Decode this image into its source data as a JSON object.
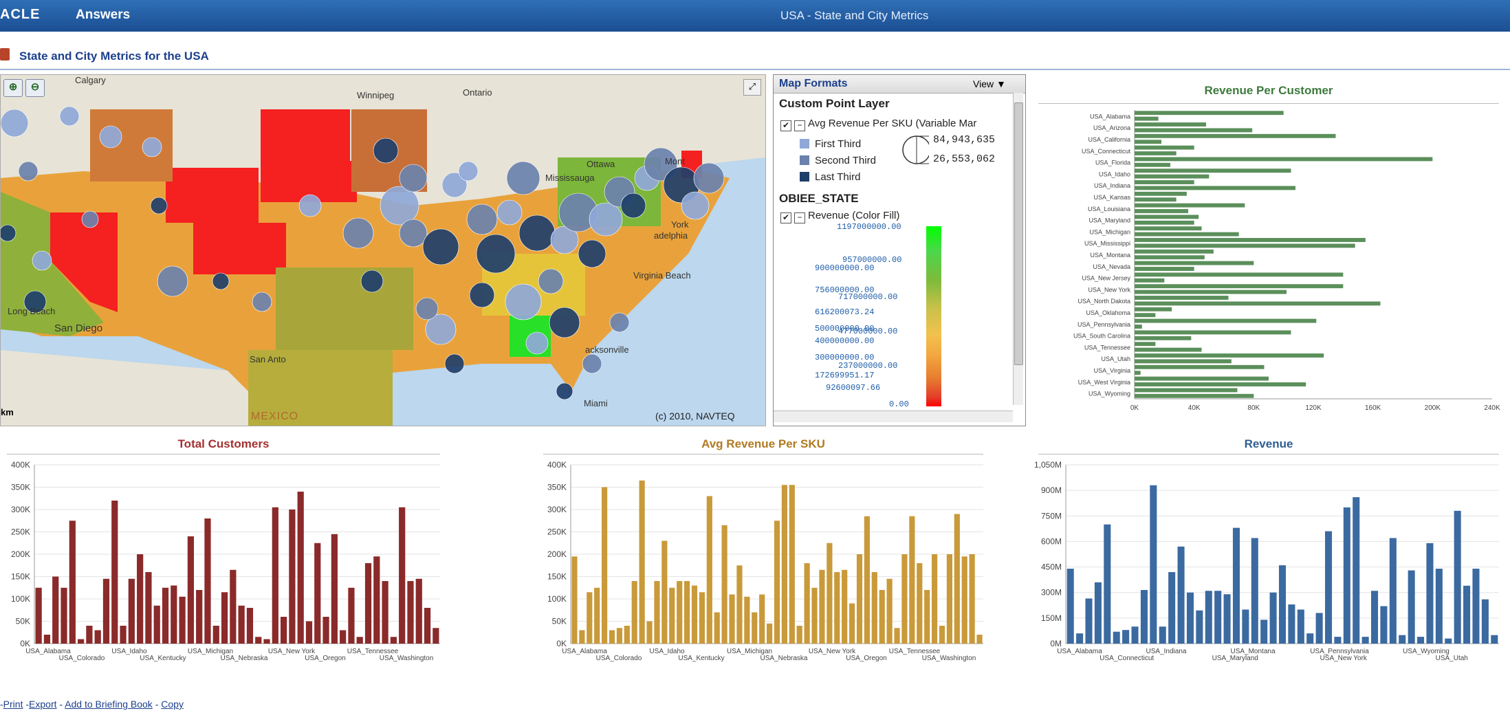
{
  "header": {
    "brand": "ACLE",
    "app": "Answers",
    "page_title": "USA - State and City Metrics"
  },
  "dashboard": {
    "title": "State and City Metrics for the USA"
  },
  "map": {
    "labels": {
      "calgary": "Calgary",
      "winnipeg": "Winnipeg",
      "ontario": "Ontario",
      "ottawa": "Ottawa",
      "montreal": "Mont",
      "mississauga": "Mississauga",
      "virginia_beach": "Virginia Beach",
      "new_york": "York",
      "philadelphia": "adelphia",
      "jacksonville": "acksonville",
      "miami": "Miami",
      "san_diego": "San Diego",
      "long_beach": "Long Beach",
      "san_antonio": "San Anto",
      "mexico": "MEXICO"
    },
    "scale_label": "km",
    "copyright": "(c) 2010, NAVTEQ"
  },
  "legend": {
    "header": "Map Formats",
    "view": "View ▼",
    "layer1_title": "Custom Point Layer",
    "layer1_item": "Avg Revenue Per SKU (Variable Mar",
    "first_third": "First Third",
    "second_third": "Second Third",
    "last_third": "Last Third",
    "max_value": "84,943,635",
    "min_value": "26,553,062",
    "colors": {
      "first": "#8fa8d8",
      "second": "#6b82ad",
      "last": "#1f3f6b"
    },
    "layer2_title": "OBIEE_STATE",
    "layer2_item": "Revenue (Color Fill)",
    "gradient_ticks": [
      "1197000000.00",
      "957000000.00",
      "900000000.00",
      "756000000.00",
      "717000000.00",
      "616200073.24",
      "500000000.00",
      "477000000.00",
      "400000000.00",
      "300000000.00",
      "237000000.00",
      "172699951.17",
      "92600097.66",
      "0.00"
    ]
  },
  "charts": {
    "total_customers": {
      "title": "Total Customers",
      "color": "#8b2a2a"
    },
    "avg_revenue_sku": {
      "title": "Avg Revenue Per SKU",
      "color": "#c99a3a"
    },
    "revenue": {
      "title": "Revenue",
      "color": "#3b6aa0"
    },
    "revenue_per_customer": {
      "title": "Revenue Per Customer",
      "color": "#5b8f5b"
    }
  },
  "chart_data": [
    {
      "type": "bar",
      "title": "Revenue Per Customer",
      "orientation": "horizontal",
      "categories": [
        "USA_Alabama",
        "USA_Arizona",
        "USA_California",
        "USA_Connecticut",
        "USA_Florida",
        "USA_Idaho",
        "USA_Indiana",
        "USA_Kansas",
        "USA_Louisiana",
        "USA_Maryland",
        "USA_Michigan",
        "USA_Mississippi",
        "USA_Montana",
        "USA_Nevada",
        "USA_New Jersey",
        "USA_New York",
        "USA_North Dakota",
        "USA_Oklahoma",
        "USA_Pennsylvania",
        "USA_South Carolina",
        "USA_Tennessee",
        "USA_Utah",
        "USA_Virginia",
        "USA_West Virginia",
        "USA_Wyoming"
      ],
      "values": [
        100000,
        16000,
        48000,
        79000,
        135000,
        18000,
        40000,
        28000,
        200000,
        24000,
        105000,
        50000,
        40000,
        108000,
        35000,
        28000,
        74000,
        36000,
        43000,
        40000,
        45000,
        70000,
        155000,
        148000,
        53000,
        47000,
        80000,
        40000,
        140000,
        20000,
        140000,
        102000,
        63000,
        165000,
        25000,
        14000,
        122000,
        5000,
        105000,
        38000,
        14000,
        45000,
        127000,
        65000,
        87000,
        4000,
        90000,
        115000,
        69000,
        80000
      ],
      "xticks": [
        "0K",
        "40K",
        "80K",
        "120K",
        "160K",
        "200K",
        "240K"
      ],
      "xlim": [
        0,
        240000
      ]
    },
    {
      "type": "bar",
      "title": "Total Customers",
      "yticks": [
        "0K",
        "50K",
        "100K",
        "150K",
        "200K",
        "250K",
        "300K",
        "350K",
        "400K"
      ],
      "ylim": [
        0,
        400000
      ],
      "xlabels_top": [
        "USA_Alabama",
        "USA_Idaho",
        "USA_Michigan",
        "USA_New York",
        "USA_Tennessee"
      ],
      "xlabels_bottom": [
        "USA_Colorado",
        "USA_Kentucky",
        "USA_Nebraska",
        "USA_Oregon",
        "USA_Washington"
      ],
      "values": [
        125000,
        20000,
        150000,
        125000,
        275000,
        10000,
        40000,
        30000,
        145000,
        320000,
        40000,
        145000,
        200000,
        160000,
        85000,
        125000,
        130000,
        105000,
        240000,
        120000,
        280000,
        40000,
        115000,
        165000,
        85000,
        80000,
        15000,
        10000,
        305000,
        60000,
        300000,
        340000,
        50000,
        225000,
        60000,
        245000,
        30000,
        125000,
        15000,
        180000,
        195000,
        140000,
        15000,
        305000,
        140000,
        145000,
        80000,
        35000
      ]
    },
    {
      "type": "bar",
      "title": "Avg Revenue Per SKU",
      "yticks": [
        "0K",
        "50K",
        "100K",
        "150K",
        "200K",
        "250K",
        "300K",
        "350K",
        "400K"
      ],
      "ylim": [
        0,
        400000
      ],
      "xlabels_top": [
        "USA_Alabama",
        "USA_Idaho",
        "USA_Michigan",
        "USA_New York",
        "USA_Tennessee"
      ],
      "xlabels_bottom": [
        "USA_Colorado",
        "USA_Kentucky",
        "USA_Nebraska",
        "USA_Oregon",
        "USA_Washington"
      ],
      "values": [
        195000,
        30000,
        115000,
        125000,
        350000,
        30000,
        35000,
        40000,
        140000,
        365000,
        50000,
        140000,
        230000,
        125000,
        140000,
        140000,
        130000,
        115000,
        330000,
        70000,
        265000,
        110000,
        175000,
        105000,
        70000,
        110000,
        45000,
        275000,
        355000,
        355000,
        40000,
        180000,
        125000,
        165000,
        225000,
        160000,
        165000,
        90000,
        200000,
        285000,
        160000,
        120000,
        145000,
        35000,
        200000,
        285000,
        180000,
        120000,
        200000,
        40000,
        200000,
        290000,
        195000,
        200000,
        20000
      ]
    },
    {
      "type": "bar",
      "title": "Revenue",
      "yticks": [
        "0M",
        "150M",
        "300M",
        "450M",
        "600M",
        "750M",
        "900M",
        "1,050M"
      ],
      "ylim": [
        0,
        1050000000
      ],
      "xlabels_top": [
        "USA_Alabama",
        "USA_Indiana",
        "USA_Montana",
        "USA_Pennsylvania",
        "USA_Wyoming"
      ],
      "xlabels_bottom": [
        "USA_Connecticut",
        "USA_Maryland",
        "USA_New York",
        "USA_Utah"
      ],
      "values": [
        440000000,
        60000000,
        265000000,
        360000000,
        700000000,
        70000000,
        80000000,
        100000000,
        315000000,
        930000000,
        100000000,
        420000000,
        570000000,
        300000000,
        195000000,
        310000000,
        310000000,
        290000000,
        680000000,
        200000000,
        620000000,
        140000000,
        300000000,
        460000000,
        230000000,
        200000000,
        60000000,
        180000000,
        660000000,
        40000000,
        800000000,
        860000000,
        40000000,
        310000000,
        220000000,
        620000000,
        50000000,
        430000000,
        40000000,
        590000000,
        440000000,
        30000000,
        780000000,
        340000000,
        440000000,
        260000000,
        50000000
      ]
    }
  ],
  "footer": {
    "print": "Print",
    "export": "Export",
    "briefing": "Add to Briefing Book",
    "copy": "Copy"
  }
}
